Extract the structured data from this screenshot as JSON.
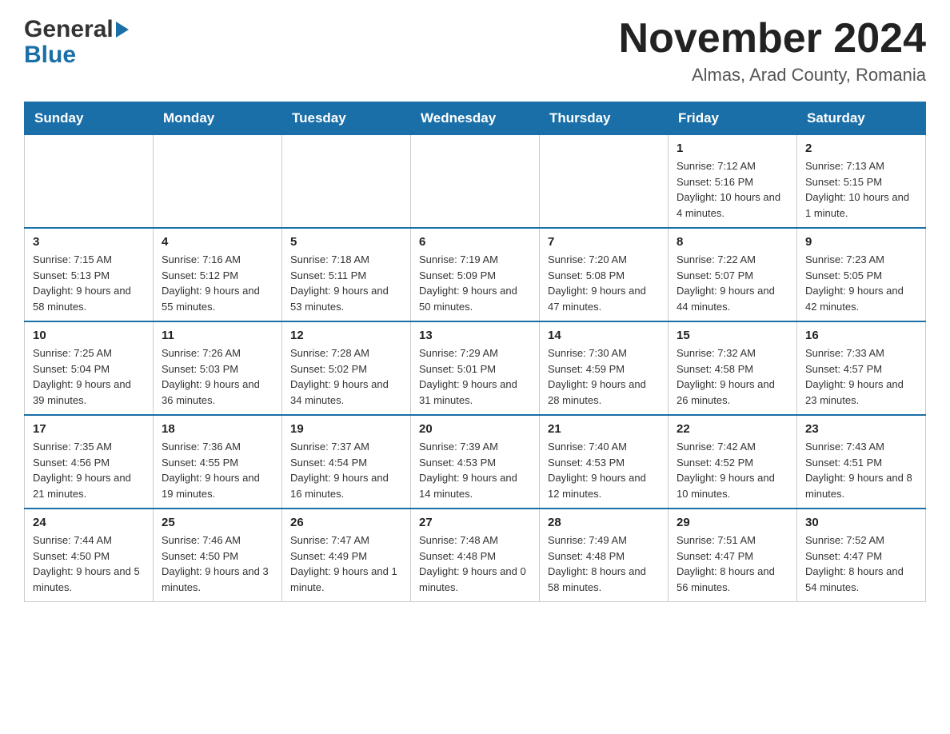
{
  "header": {
    "title": "November 2024",
    "subtitle": "Almas, Arad County, Romania",
    "logo_general": "General",
    "logo_blue": "Blue"
  },
  "days_of_week": [
    "Sunday",
    "Monday",
    "Tuesday",
    "Wednesday",
    "Thursday",
    "Friday",
    "Saturday"
  ],
  "weeks": [
    {
      "days": [
        {
          "number": "",
          "info": "",
          "empty": true
        },
        {
          "number": "",
          "info": "",
          "empty": true
        },
        {
          "number": "",
          "info": "",
          "empty": true
        },
        {
          "number": "",
          "info": "",
          "empty": true
        },
        {
          "number": "",
          "info": "",
          "empty": true
        },
        {
          "number": "1",
          "info": "Sunrise: 7:12 AM\nSunset: 5:16 PM\nDaylight: 10 hours and 4 minutes."
        },
        {
          "number": "2",
          "info": "Sunrise: 7:13 AM\nSunset: 5:15 PM\nDaylight: 10 hours and 1 minute."
        }
      ]
    },
    {
      "days": [
        {
          "number": "3",
          "info": "Sunrise: 7:15 AM\nSunset: 5:13 PM\nDaylight: 9 hours and 58 minutes."
        },
        {
          "number": "4",
          "info": "Sunrise: 7:16 AM\nSunset: 5:12 PM\nDaylight: 9 hours and 55 minutes."
        },
        {
          "number": "5",
          "info": "Sunrise: 7:18 AM\nSunset: 5:11 PM\nDaylight: 9 hours and 53 minutes."
        },
        {
          "number": "6",
          "info": "Sunrise: 7:19 AM\nSunset: 5:09 PM\nDaylight: 9 hours and 50 minutes."
        },
        {
          "number": "7",
          "info": "Sunrise: 7:20 AM\nSunset: 5:08 PM\nDaylight: 9 hours and 47 minutes."
        },
        {
          "number": "8",
          "info": "Sunrise: 7:22 AM\nSunset: 5:07 PM\nDaylight: 9 hours and 44 minutes."
        },
        {
          "number": "9",
          "info": "Sunrise: 7:23 AM\nSunset: 5:05 PM\nDaylight: 9 hours and 42 minutes."
        }
      ]
    },
    {
      "days": [
        {
          "number": "10",
          "info": "Sunrise: 7:25 AM\nSunset: 5:04 PM\nDaylight: 9 hours and 39 minutes."
        },
        {
          "number": "11",
          "info": "Sunrise: 7:26 AM\nSunset: 5:03 PM\nDaylight: 9 hours and 36 minutes."
        },
        {
          "number": "12",
          "info": "Sunrise: 7:28 AM\nSunset: 5:02 PM\nDaylight: 9 hours and 34 minutes."
        },
        {
          "number": "13",
          "info": "Sunrise: 7:29 AM\nSunset: 5:01 PM\nDaylight: 9 hours and 31 minutes."
        },
        {
          "number": "14",
          "info": "Sunrise: 7:30 AM\nSunset: 4:59 PM\nDaylight: 9 hours and 28 minutes."
        },
        {
          "number": "15",
          "info": "Sunrise: 7:32 AM\nSunset: 4:58 PM\nDaylight: 9 hours and 26 minutes."
        },
        {
          "number": "16",
          "info": "Sunrise: 7:33 AM\nSunset: 4:57 PM\nDaylight: 9 hours and 23 minutes."
        }
      ]
    },
    {
      "days": [
        {
          "number": "17",
          "info": "Sunrise: 7:35 AM\nSunset: 4:56 PM\nDaylight: 9 hours and 21 minutes."
        },
        {
          "number": "18",
          "info": "Sunrise: 7:36 AM\nSunset: 4:55 PM\nDaylight: 9 hours and 19 minutes."
        },
        {
          "number": "19",
          "info": "Sunrise: 7:37 AM\nSunset: 4:54 PM\nDaylight: 9 hours and 16 minutes."
        },
        {
          "number": "20",
          "info": "Sunrise: 7:39 AM\nSunset: 4:53 PM\nDaylight: 9 hours and 14 minutes."
        },
        {
          "number": "21",
          "info": "Sunrise: 7:40 AM\nSunset: 4:53 PM\nDaylight: 9 hours and 12 minutes."
        },
        {
          "number": "22",
          "info": "Sunrise: 7:42 AM\nSunset: 4:52 PM\nDaylight: 9 hours and 10 minutes."
        },
        {
          "number": "23",
          "info": "Sunrise: 7:43 AM\nSunset: 4:51 PM\nDaylight: 9 hours and 8 minutes."
        }
      ]
    },
    {
      "days": [
        {
          "number": "24",
          "info": "Sunrise: 7:44 AM\nSunset: 4:50 PM\nDaylight: 9 hours and 5 minutes."
        },
        {
          "number": "25",
          "info": "Sunrise: 7:46 AM\nSunset: 4:50 PM\nDaylight: 9 hours and 3 minutes."
        },
        {
          "number": "26",
          "info": "Sunrise: 7:47 AM\nSunset: 4:49 PM\nDaylight: 9 hours and 1 minute."
        },
        {
          "number": "27",
          "info": "Sunrise: 7:48 AM\nSunset: 4:48 PM\nDaylight: 9 hours and 0 minutes."
        },
        {
          "number": "28",
          "info": "Sunrise: 7:49 AM\nSunset: 4:48 PM\nDaylight: 8 hours and 58 minutes."
        },
        {
          "number": "29",
          "info": "Sunrise: 7:51 AM\nSunset: 4:47 PM\nDaylight: 8 hours and 56 minutes."
        },
        {
          "number": "30",
          "info": "Sunrise: 7:52 AM\nSunset: 4:47 PM\nDaylight: 8 hours and 54 minutes."
        }
      ]
    }
  ]
}
